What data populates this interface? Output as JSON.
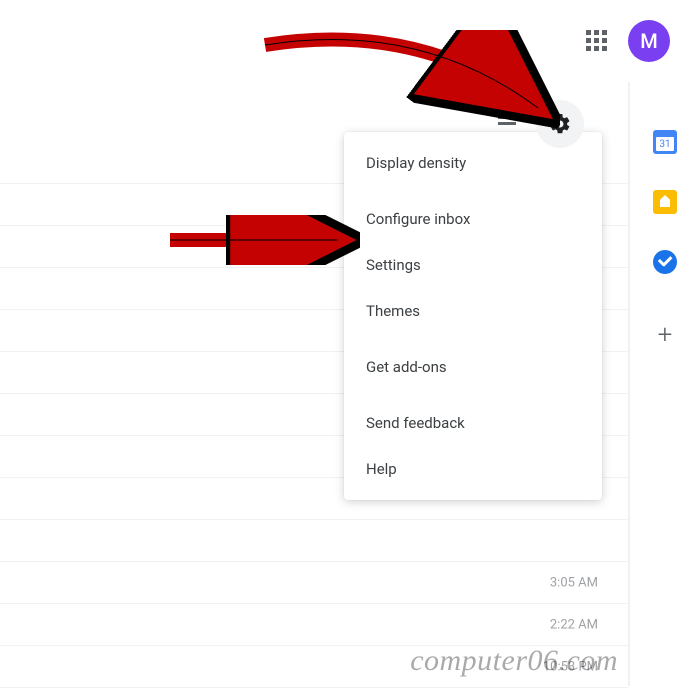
{
  "header": {
    "avatar_initial": "M",
    "calendar_day": "31"
  },
  "toolbar": {
    "gear_name": "gear-icon",
    "split_name": "layout-toggle"
  },
  "menu": {
    "items": [
      {
        "label": "Display density"
      },
      {
        "label": "Configure inbox"
      },
      {
        "label": "Settings"
      },
      {
        "label": "Themes"
      },
      {
        "label": "Get add-ons"
      },
      {
        "label": "Send feedback"
      },
      {
        "label": "Help"
      }
    ]
  },
  "side_panel": {
    "add_glyph": "+"
  },
  "mail_rows": [
    {
      "time": ""
    },
    {
      "time": ""
    },
    {
      "time": ""
    },
    {
      "time": ""
    },
    {
      "time": ""
    },
    {
      "time": ""
    },
    {
      "time": ""
    },
    {
      "time": ""
    },
    {
      "time": ""
    },
    {
      "time": ""
    },
    {
      "time": "3:05 AM"
    },
    {
      "time": "2:22 AM"
    },
    {
      "time": "10:53 PM"
    }
  ],
  "watermark": "computer06.com"
}
